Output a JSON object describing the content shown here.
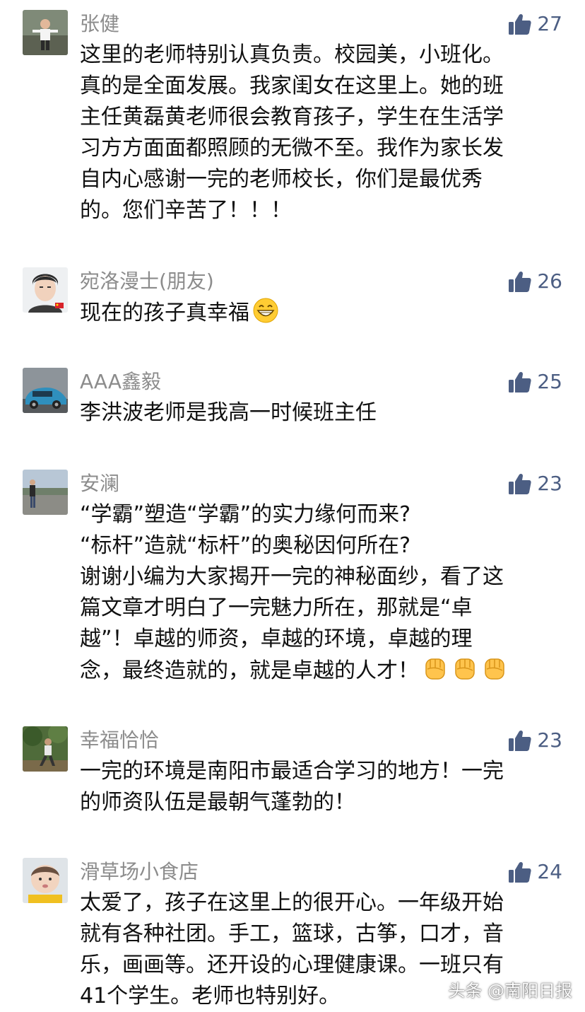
{
  "colors": {
    "name": "#8c8c8c",
    "like": "#4c5e83",
    "text": "#111111"
  },
  "comments": [
    {
      "name": "张健",
      "likes": "27",
      "lines": [
        "这里的老师特别认真负责。校园美，小班化。",
        "真的是全面发展。我家闺女在这里上。她的班",
        "主任黄磊黄老师很会教育孩子，学生在生活学",
        "习方方面面都照顾的无微不至。我作为家长发",
        "自内心感谢一完的老师校长，你们是最优秀",
        "的。您们辛苦了！！！"
      ]
    },
    {
      "name": "宛洛漫士(朋友)",
      "likes": "26",
      "lines": [
        "现在的孩子真幸福"
      ],
      "emoji": "grin-emoji"
    },
    {
      "name": "AAA鑫毅",
      "likes": "25",
      "lines": [
        "李洪波老师是我高一时候班主任"
      ]
    },
    {
      "name": "安澜",
      "likes": "23",
      "lines": [
        "“学霸”塑造“学霸”的实力缘何而来?",
        "“标杆”造就“标杆”的奥秘因何所在?",
        "谢谢小编为大家揭开一完的神秘面纱，看了这",
        "篇文章才明白了一完魅力所在，那就是“卓",
        "越”！卓越的师资，卓越的环境，卓越的理",
        "念，最终造就的，就是卓越的人才！"
      ],
      "emoji": "fist-emoji"
    },
    {
      "name": "幸福恰恰",
      "likes": "23",
      "lines": [
        "一完的环境是南阳市最适合学习的地方！一完",
        "的师资队伍是最朝气蓬勃的！"
      ]
    },
    {
      "name": "滑草场小食店",
      "likes": "24",
      "lines": [
        "太爱了，孩子在这里上的很开心。一年级开始",
        "就有各种社团。手工，篮球，古筝，口才，音",
        "乐，画画等。还开设的心理健康课。一班只有",
        "41个学生。老师也特别好。"
      ]
    }
  ],
  "watermark": "头条 @南阳日报"
}
